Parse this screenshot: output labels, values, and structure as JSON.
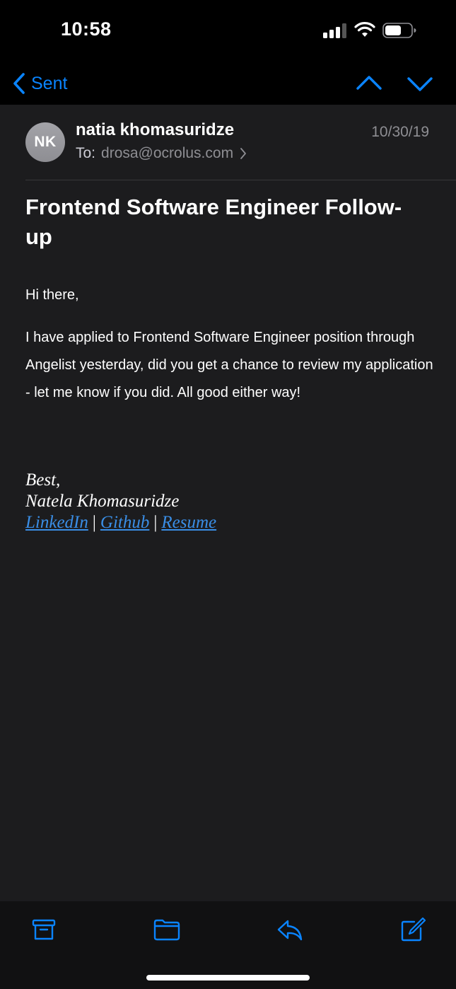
{
  "status_bar": {
    "time": "10:58"
  },
  "nav": {
    "back_label": "Sent"
  },
  "email": {
    "sender_initials": "NK",
    "sender_name": "natia khomasuridze",
    "date": "10/30/19",
    "to_label": "To:",
    "to_address": "drosa@ocrolus.com",
    "subject": "Frontend Software Engineer Follow-up",
    "greeting": "Hi there,",
    "body": "I have applied to Frontend Software Engineer position through Angelist yesterday, did you get a chance to review my application - let me know if you did. All good either way!",
    "signature": {
      "closing": "Best,",
      "name": "Natela Khomasuridze",
      "links": [
        "LinkedIn",
        "Github",
        "Resume"
      ],
      "separator": "|"
    }
  },
  "toolbar": {
    "icons": [
      "archive-icon",
      "folder-icon",
      "reply-icon",
      "compose-icon"
    ]
  },
  "colors": {
    "accent": "#0a84ff",
    "link": "#3a8ee6",
    "background": "#1c1c1e",
    "secondary_text": "#8e8e93"
  }
}
